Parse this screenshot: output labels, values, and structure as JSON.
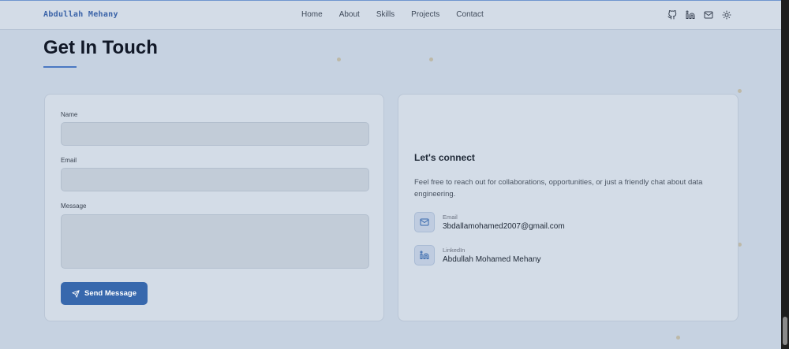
{
  "nav": {
    "brand": "Abdullah Mehany",
    "links": [
      "Home",
      "About",
      "Skills",
      "Projects",
      "Contact"
    ],
    "icons": [
      "github-icon",
      "linkedin-icon",
      "mail-icon",
      "sun-icon"
    ]
  },
  "section": {
    "title": "Get In Touch"
  },
  "form": {
    "name_label": "Name",
    "email_label": "Email",
    "message_label": "Message",
    "name_value": "",
    "email_value": "",
    "message_value": "",
    "submit_label": "Send Message"
  },
  "connect": {
    "title": "Let's connect",
    "description": "Feel free to reach out for collaborations, opportunities, or just a friendly chat about data engineering.",
    "email_label": "Email",
    "email_value": "3bdallamohamed2007@gmail.com",
    "linkedin_label": "LinkedIn",
    "linkedin_value": "Abdullah Mohamed Mehany"
  },
  "colors": {
    "accent": "#3768ad",
    "background": "#c6d2e1",
    "card": "#d3dce7"
  }
}
